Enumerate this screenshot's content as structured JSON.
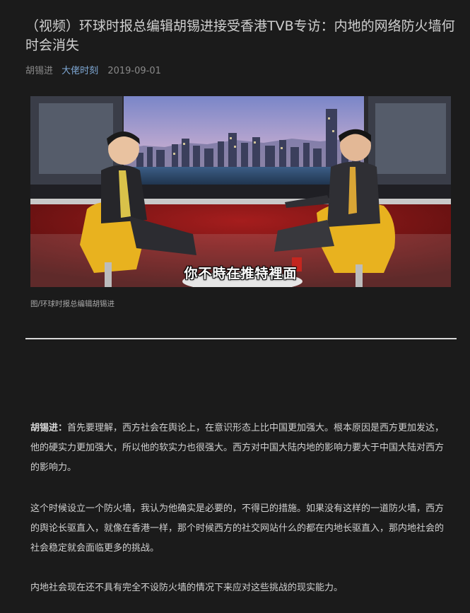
{
  "article": {
    "title": "（视频）环球时报总编辑胡锡进接受香港TVB专访：内地的网络防火墙何时会消失",
    "author": "胡锡进",
    "channel": "大佬时刻",
    "date": "2019-09-01"
  },
  "video": {
    "subtitle": "你不時在推特裡面",
    "caption": "图/环球时报总编辑胡锡进"
  },
  "body": {
    "p1_speaker": "胡锡进：",
    "p1_text": "首先要理解，西方社会在舆论上，在意识形态上比中国更加强大。根本原因是西方更加发达，他的硬实力更加强大，所以他的软实力也很强大。西方对中国大陆内地的影响力要大于中国大陆对西方的影响力。",
    "p2_text": "这个时候设立一个防火墙，我认为他确实是必要的，不得已的措施。如果没有这样的一道防火墙，西方的舆论长驱直入，就像在香港一样，那个时候西方的社交网站什么的都在内地长驱直入，那内地社会的社会稳定就会面临更多的挑战。",
    "p3_text": "内地社会现在还不具有完全不设防火墙的情况下来应对这些挑战的现实能力。"
  },
  "colors": {
    "background": "#1b1b1b",
    "channel_link": "#7fa9d6",
    "chair_yellow": "#e8b21f",
    "studio_red": "#7a1414"
  }
}
